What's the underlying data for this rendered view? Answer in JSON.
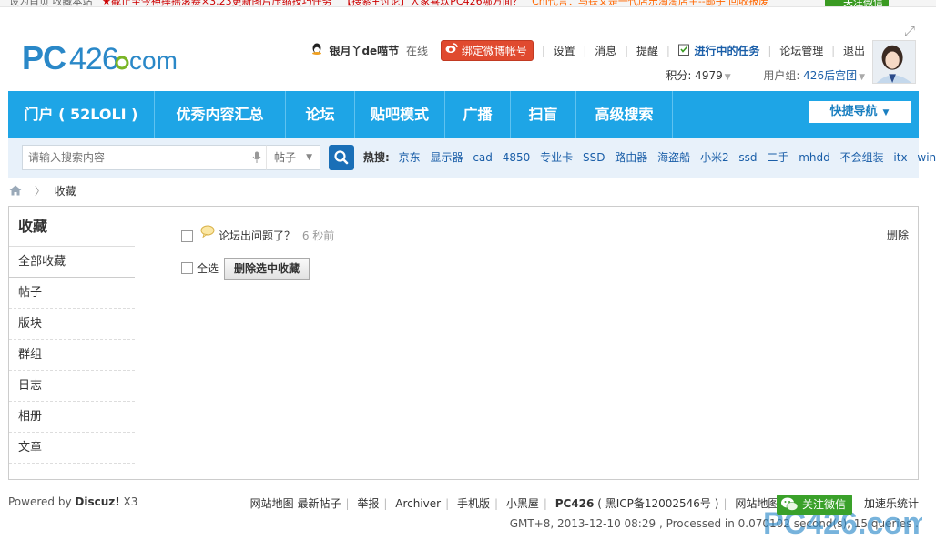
{
  "topbar": {
    "ticker_1": "设为首页  收藏本站",
    "ticker_2": "★截止至今神摔摇滚赛×3.23更新图片压缩技巧任务",
    "ticker_3": "【搜索+讨论】大家喜欢PC426哪方面？",
    "ticker_4": "Chi代言：马铁又是一代店乐淘淘店主--邮子 回收报废",
    "wechat_btn": "关注微信"
  },
  "logo": {
    "text": "PC426.com",
    "brand_color": "#2a88c8",
    "accent_color": "#7ab526"
  },
  "user": {
    "name": "银月丫de喵节",
    "status": "在线",
    "bind_weibo": "绑定微博帐号",
    "links": [
      "设置",
      "消息",
      "提醒"
    ],
    "task": "进行中的任务",
    "manage": "论坛管理",
    "logout": "退出",
    "points_label": "积分: 4979",
    "group_label": "用户组: ",
    "group_value": "426后宫团"
  },
  "nav": {
    "items": [
      "门户 ( 52LOLI )",
      "优秀内容汇总",
      "论坛",
      "贴吧模式",
      "广播",
      "扫盲",
      "高级搜索"
    ],
    "quick": "快捷导航",
    "bg_color": "#1ea5e6"
  },
  "search": {
    "placeholder": "请输入搜索内容",
    "scope": "帖子",
    "hot_label": "热搜:",
    "hot_terms": [
      "京东",
      "显示器",
      "cad",
      "4850",
      "专业卡",
      "SSD",
      "路由器",
      "海盗船",
      "小米2",
      "ssd",
      "二手",
      "mhdd",
      "不会组装",
      "itx",
      "win7"
    ]
  },
  "breadcrumb": {
    "current": "收藏"
  },
  "sidebar": {
    "title": "收藏",
    "all": "全部收藏",
    "items": [
      "帖子",
      "版块",
      "群组",
      "日志",
      "相册",
      "文章"
    ]
  },
  "favorites": {
    "items": [
      {
        "title": "论坛出问题了？",
        "time": "6 秒前",
        "delete": "删除"
      }
    ],
    "select_all": "全选",
    "delete_selected": "删除选中收藏"
  },
  "footer": {
    "powered_by": "Powered by ",
    "discuz": "Discuz!",
    "version": " X3",
    "links": [
      "网站地图 最新帖子",
      "举报",
      "Archiver",
      "手机版",
      "小黑屋"
    ],
    "site_name": "PC426",
    "icp": " ( 黑ICP备12002546号 )",
    "sitemap": "网站地图",
    "stats": "加速乐统计",
    "meta": "GMT+8, 2013-12-10 08:29 , Processed in 0.070102 second(s), 15 queries .",
    "wechat_float": "关注微信"
  }
}
